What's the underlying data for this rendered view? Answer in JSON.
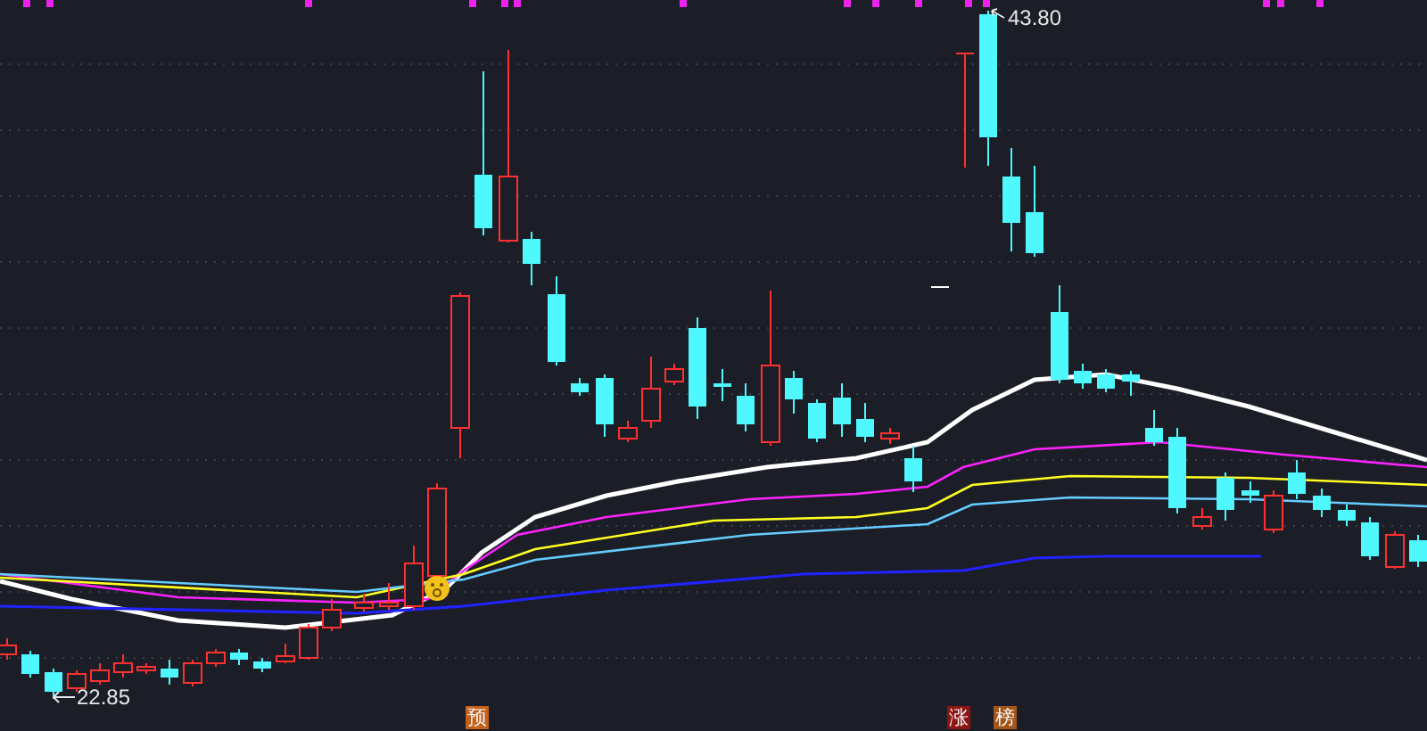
{
  "chart": {
    "high_label": "43.80",
    "low_label": "22.85"
  },
  "markers": [
    {
      "text": "预",
      "color": "#c4601a"
    },
    {
      "text": "涨",
      "color": "#8e1414"
    },
    {
      "text": "榜",
      "color": "#a4561a"
    }
  ]
}
